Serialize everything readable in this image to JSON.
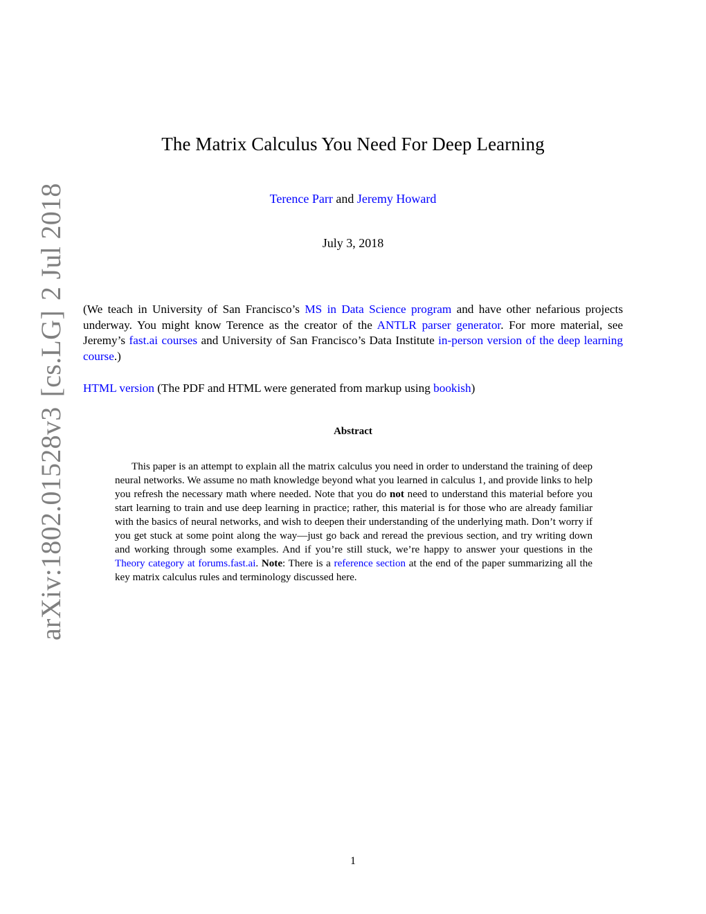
{
  "paper": {
    "title": "The Matrix Calculus You Need For Deep Learning",
    "authors": {
      "author1": "Terence Parr",
      "connector": " and ",
      "author2": "Jeremy Howard"
    },
    "date": "July 3, 2018",
    "intro": {
      "t1": "(We teach in University of San Francisco’s ",
      "l1": "MS in Data Science program",
      "t2": " and have other nefarious projects underway. You might know Terence as the creator of the ",
      "l2": "ANTLR parser generator",
      "t3": ". For more material, see Jeremy’s ",
      "l3": "fast.ai courses",
      "t4": " and University of San Francisco’s Data Institute ",
      "l4": "in-person version of the deep learning course",
      "t5": ".)"
    },
    "html_version": {
      "link": "HTML version",
      "t1": " (The PDF and HTML were generated from markup using ",
      "l2": "bookish",
      "t2": ")"
    },
    "abstract": {
      "heading": "Abstract",
      "t1": "This paper is an attempt to explain all the matrix calculus you need in order to understand the training of deep neural networks. We assume no math knowledge beyond what you learned in calculus 1, and provide links to help you refresh the necessary math where needed. Note that you do ",
      "bold1": "not",
      "t2": " need to understand this material before you start learning to train and use deep learning in practice; rather, this material is for those who are already familiar with the basics of neural networks, and wish to deepen their understanding of the underlying math. Don’t worry if you get stuck at some point along the way—just go back and reread the previous section, and try writing down and working through some examples. And if you’re still stuck, we’re happy to answer your questions in the ",
      "l1": "Theory category at forums.fast.ai",
      "t3": ". ",
      "bold2": "Note",
      "t4": ": There is a ",
      "l2": "reference section",
      "t5": " at the end of the paper summarizing all the key matrix calculus rules and terminology discussed here."
    },
    "arxiv_stamp": {
      "id": "arXiv:1802.01528v3",
      "category": "[cs.LG]",
      "date": "2 Jul 2018"
    },
    "page_number": "1"
  },
  "colors": {
    "link": "#0000ff",
    "stamp": "#808080",
    "text": "#000000"
  }
}
